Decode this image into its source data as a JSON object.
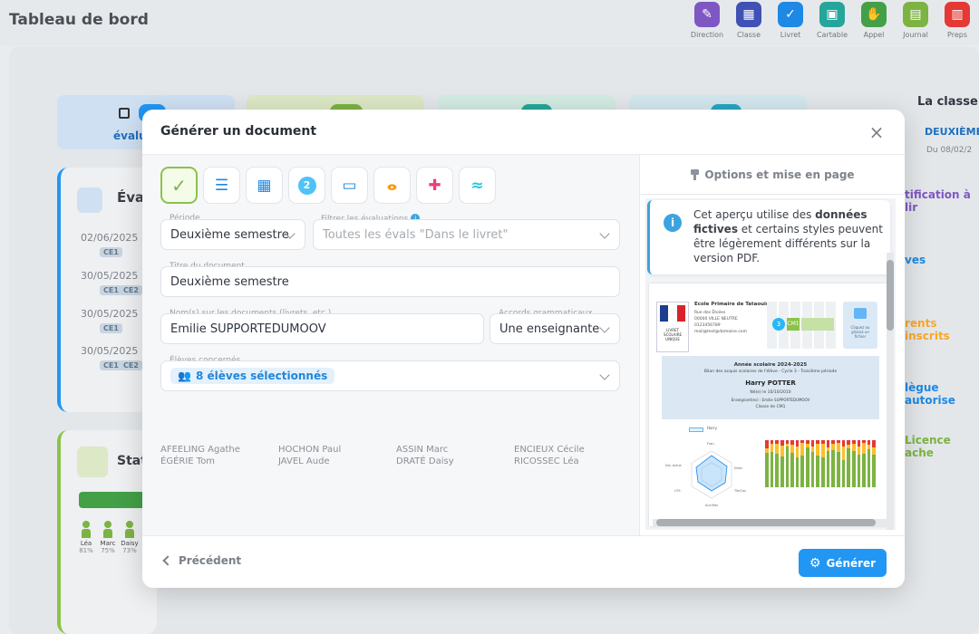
{
  "page_title": "Tableau de bord",
  "topnav": [
    {
      "label": "Direction",
      "icon": "pen-icon",
      "color": "#7e57c2",
      "glyph": "✎"
    },
    {
      "label": "Classe",
      "icon": "board-icon",
      "color": "#3f51b5",
      "glyph": "▦"
    },
    {
      "label": "Livret",
      "icon": "check-icon",
      "color": "#1e88e5",
      "glyph": "✓"
    },
    {
      "label": "Cartable",
      "icon": "briefcase-icon",
      "color": "#26a69a",
      "glyph": "▣"
    },
    {
      "label": "Appel",
      "icon": "hand-icon",
      "color": "#43a047",
      "glyph": "✋"
    },
    {
      "label": "Journal",
      "icon": "calendar-icon",
      "color": "#7cb342",
      "glyph": "▤"
    },
    {
      "label": "Preps",
      "icon": "clipboard-icon",
      "color": "#e53935",
      "glyph": "▥"
    }
  ],
  "background": {
    "tab_label": "évalu",
    "card1_title": "Éva",
    "eval_dates": [
      "02/06/2025",
      "30/05/2025",
      "30/05/2025",
      "30/05/2025"
    ],
    "eval_chips": [
      [
        "CE1"
      ],
      [
        "CE1",
        "CE2"
      ],
      [
        "CE1"
      ],
      [
        "CE1",
        "CE2"
      ]
    ],
    "card2_title": "Stat",
    "stat_students": [
      {
        "name": "Léa",
        "pct": "81%"
      },
      {
        "name": "Marc",
        "pct": "75%"
      },
      {
        "name": "Daisy",
        "pct": "73%"
      }
    ],
    "right_title": "La classe",
    "right_sub": "DEUXIÈME",
    "right_date": "Du 08/02/2",
    "right_lines": [
      "tification à lir",
      "ves",
      "rents inscrits",
      "lègue autorise",
      "Licence ache"
    ]
  },
  "modal": {
    "title": "Générer un document",
    "close_label": "×",
    "doc_types": [
      {
        "icon": "check-icon",
        "glyph": "✓",
        "color": "#7cb342",
        "active": true
      },
      {
        "icon": "list-icon",
        "glyph": "☰",
        "color": "#1e88e5"
      },
      {
        "icon": "grid-icon",
        "glyph": "▦",
        "color": "#1e88e5"
      },
      {
        "icon": "number-two-icon",
        "glyph": "2",
        "color": "#4fc3f7"
      },
      {
        "icon": "computer-icon",
        "glyph": "▭",
        "color": "#1e88e5"
      },
      {
        "icon": "bicycle-icon",
        "glyph": "ⴰ",
        "color": "#ff9800"
      },
      {
        "icon": "first-aid-kit-icon",
        "glyph": "✚",
        "color": "#ec407a"
      },
      {
        "icon": "swimming-icon",
        "glyph": "≈",
        "color": "#26c6da"
      }
    ],
    "periode": {
      "label": "Période",
      "value": "Deuxième semestre"
    },
    "filtre": {
      "label": "Filtrer les évaluations",
      "info": "i",
      "placeholder": "Toutes les évals \"Dans le livret\""
    },
    "titre_doc": {
      "label": "Titre du document",
      "value": "Deuxième semestre"
    },
    "noms": {
      "label": "Nom(s) sur les documents (livrets, etc.)",
      "value": "Emilie SUPPORTEDUMOOV"
    },
    "accords": {
      "label": "Accords grammaticaux",
      "value": "Une enseignante"
    },
    "eleves": {
      "label": "Élèves concernés",
      "selected": "8 élèves sélectionnés"
    },
    "students": [
      "AFEELING Agathe",
      "HOCHON Paul",
      "ASSIN Marc",
      "ENCIEUX Cécile",
      "ÉGÉRIE Tom",
      "JAVEL Aude",
      "DRATÉ Daisy",
      "RICOSSEC Léa"
    ],
    "options_title": "Options et mise en page",
    "notice": {
      "icon": "i",
      "pre": "Cet aperçu utilise des ",
      "bold": "données fictives",
      "post": " et certains styles peuvent être légèrement différents sur la version PDF."
    },
    "doc_preview": {
      "school": "Ecole Primaire de Tataouine",
      "address": [
        "Rue des Étoiles",
        "00000 VILLE NEUTRE",
        "0123456789",
        "mail@test@domaine.com"
      ],
      "livret": [
        "LIVRET",
        "SCOLAIRE",
        "UNIQUE"
      ],
      "cycle_num": "3",
      "cycle_label": "CM1",
      "upload_hint": [
        "Cliquez ou",
        "glissez un",
        "fichier"
      ],
      "year": "Année scolaire 2024-2025",
      "bilan": "Bilan des acquis scolaires de l'élève - Cycle 3 - Troisième période",
      "student": "Harry POTTER",
      "birth": "Né(e) le 10/10/2010",
      "teacher": "Enseignant(es) : Emilie SUPPORTEDUMOOV",
      "class": "Classe de CM1",
      "radar_legend": "Harry",
      "radar_axes": [
        "Fran.",
        "Dnes",
        "Tlb/Cas",
        "Aut.Mes",
        "CFS",
        "Div. Actue"
      ]
    },
    "footer": {
      "prev_label": "Précédent",
      "generate_label": "Générer"
    }
  }
}
